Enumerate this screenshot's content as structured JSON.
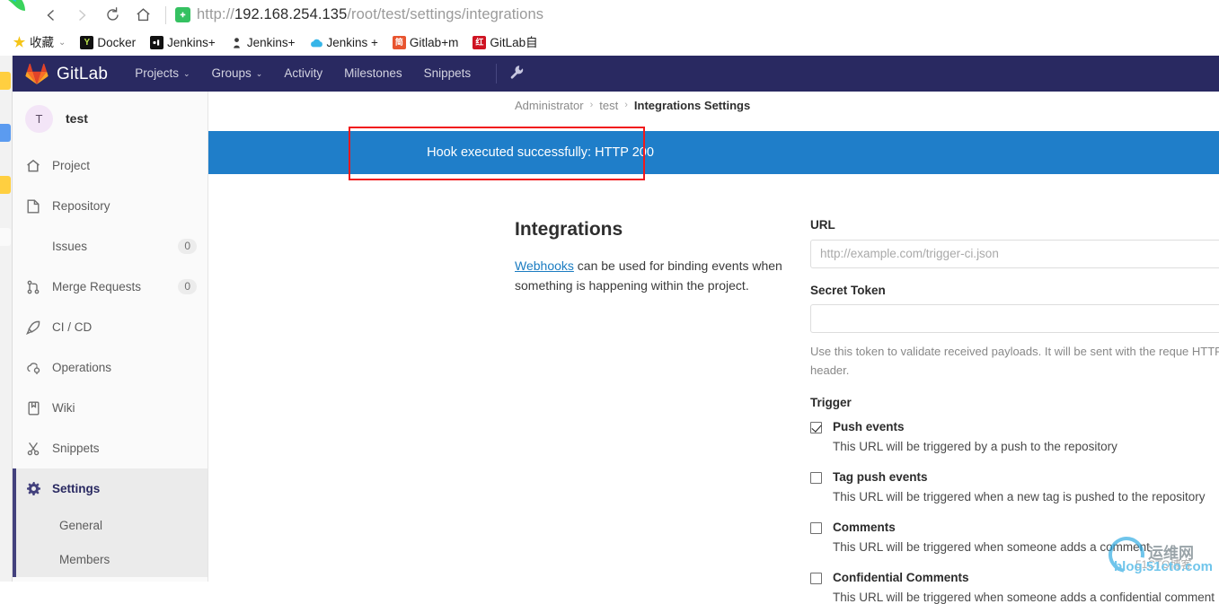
{
  "browser": {
    "nav": {
      "back_icon": "chevron-left-icon",
      "forward_icon": "chevron-right-icon",
      "reload_icon": "reload-icon",
      "home_icon": "home-icon"
    },
    "address": {
      "security_icon": "shield-check-icon",
      "scheme": "http://",
      "host": "192.168.254.135",
      "path": "/root/test/settings/integrations"
    },
    "bookmarks": [
      {
        "label": "收藏",
        "icon": "star-icon",
        "caret": "⌄"
      },
      {
        "label": "Docker",
        "icon": "docker-icon",
        "glyph": "Y"
      },
      {
        "label": "Jenkins+",
        "icon": "jenkins-icon",
        "glyph": "[•]"
      },
      {
        "label": "Jenkins+",
        "icon": "jenkins-butler-icon",
        "glyph": "⚗"
      },
      {
        "label": "Jenkins +",
        "icon": "cloud-icon",
        "glyph": "☁"
      },
      {
        "label": "Gitlab+m",
        "icon": "jian-icon",
        "glyph": "简"
      },
      {
        "label": "GitLab自",
        "icon": "hong-icon",
        "glyph": "红"
      }
    ]
  },
  "navbar": {
    "brand": "GitLab",
    "logo_icon": "gitlab-tanuki-icon",
    "links": [
      {
        "label": "Projects",
        "caret": "⌄"
      },
      {
        "label": "Groups",
        "caret": "⌄"
      },
      {
        "label": "Activity",
        "caret": ""
      },
      {
        "label": "Milestones",
        "caret": ""
      },
      {
        "label": "Snippets",
        "caret": ""
      }
    ],
    "wrench_icon": "wrench-icon",
    "wrench_glyph": "🔧"
  },
  "sidebar": {
    "project": {
      "avatar_letter": "T",
      "name": "test"
    },
    "items": [
      {
        "label": "Project",
        "icon": "home-icon",
        "glyph": "⌂",
        "badge": ""
      },
      {
        "label": "Repository",
        "icon": "document-icon",
        "glyph": "⎘",
        "badge": ""
      },
      {
        "label": "Issues",
        "icon": "",
        "glyph": "",
        "badge": "0"
      },
      {
        "label": "Merge Requests",
        "icon": "merge-request-icon",
        "glyph": "⑂",
        "badge": "0"
      },
      {
        "label": "CI / CD",
        "icon": "rocket-icon",
        "glyph": "✈",
        "badge": ""
      },
      {
        "label": "Operations",
        "icon": "cloud-gear-icon",
        "glyph": "☁",
        "badge": ""
      },
      {
        "label": "Wiki",
        "icon": "book-icon",
        "glyph": "▯",
        "badge": ""
      },
      {
        "label": "Snippets",
        "icon": "scissors-icon",
        "glyph": "✂",
        "badge": ""
      }
    ],
    "settings": {
      "label": "Settings",
      "icon": "gear-icon",
      "glyph": "⚙"
    },
    "settings_sub": [
      {
        "label": "General"
      },
      {
        "label": "Members"
      }
    ]
  },
  "breadcrumb": {
    "items": [
      "Administrator",
      "test"
    ],
    "current": "Integrations Settings",
    "separator": "›"
  },
  "flash": {
    "message": "Hook executed successfully: HTTP 200",
    "background": "#1f7ec9",
    "annotation_color": "#f1191c"
  },
  "main": {
    "heading": "Integrations",
    "description_link": "Webhooks",
    "description_rest": " can be used for binding events when something is happening within the project."
  },
  "form": {
    "url": {
      "label": "URL",
      "value": "",
      "placeholder": "http://example.com/trigger-ci.json"
    },
    "secret_token": {
      "label": "Secret Token",
      "value": "",
      "placeholder": "",
      "help": "Use this token to validate received payloads. It will be sent with the reque HTTP header."
    },
    "trigger_label": "Trigger",
    "triggers": [
      {
        "label": "Push events",
        "checked": true,
        "description": "This URL will be triggered by a push to the repository"
      },
      {
        "label": "Tag push events",
        "checked": false,
        "description": "This URL will be triggered when a new tag is pushed to the repository"
      },
      {
        "label": "Comments",
        "checked": false,
        "description": "This URL will be triggered when someone adds a comment"
      },
      {
        "label": "Confidential Comments",
        "checked": false,
        "description": "This URL will be triggered when someone adds a confidential comment"
      }
    ]
  },
  "watermark": {
    "cn": "运维网",
    "en": "blog.51cto.com",
    "sub": "51CTO博客"
  }
}
